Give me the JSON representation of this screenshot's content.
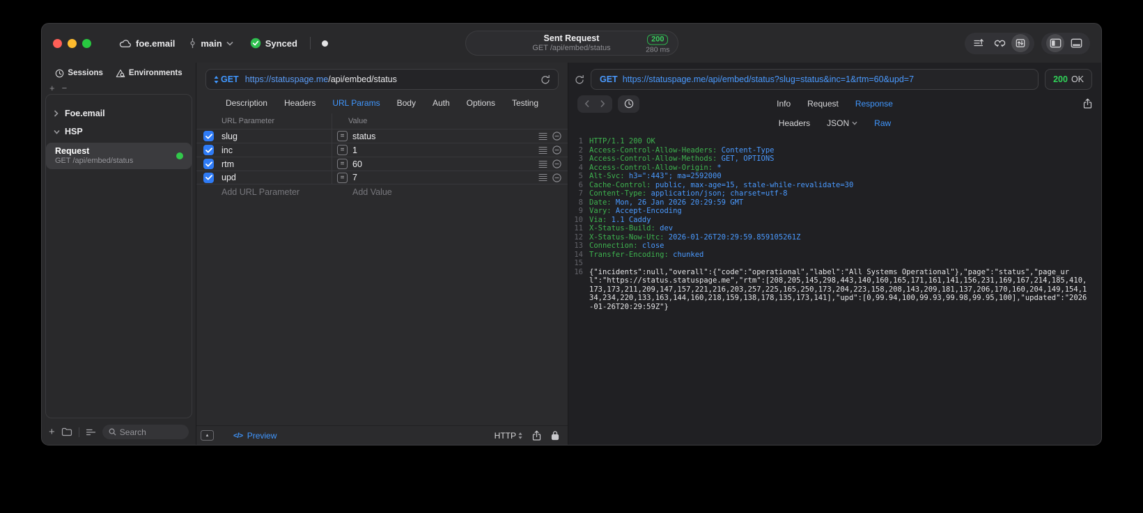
{
  "titlebar": {
    "project": "foe.email",
    "branch": "main",
    "sync_status": "Synced",
    "request_summary": {
      "title": "Sent Request",
      "subtitle": "GET /api/embed/status",
      "status_code": "200",
      "duration": "280 ms"
    }
  },
  "sidebar": {
    "tabs": [
      {
        "label": "Sessions"
      },
      {
        "label": "Environments"
      }
    ],
    "groups": [
      {
        "label": "Foe.email",
        "expanded": false
      },
      {
        "label": "HSP",
        "expanded": true
      }
    ],
    "selected_request": {
      "title": "Request",
      "subtitle": "GET /api/embed/status"
    },
    "search_placeholder": "Search"
  },
  "request_editor": {
    "method": "GET",
    "url_host": "https://statuspage.me",
    "url_path": "/api/embed/status",
    "tabs": [
      "Description",
      "Headers",
      "URL Params",
      "Body",
      "Auth",
      "Options",
      "Testing"
    ],
    "active_tab": "URL Params",
    "params_table": {
      "columns": [
        "URL Parameter",
        "Value"
      ],
      "rows": [
        {
          "enabled": true,
          "name": "slug",
          "value": "status"
        },
        {
          "enabled": true,
          "name": "inc",
          "value": "1"
        },
        {
          "enabled": true,
          "name": "rtm",
          "value": "60"
        },
        {
          "enabled": true,
          "name": "upd",
          "value": "7"
        }
      ],
      "add_parameter_placeholder": "Add URL Parameter",
      "add_value_placeholder": "Add Value"
    },
    "footer": {
      "preview_label": "Preview",
      "code_glyph": "</>",
      "protocol_selector": "HTTP"
    }
  },
  "response_viewer": {
    "request_method": "GET",
    "request_url": "https://statuspage.me/api/embed/status?slug=status&inc=1&rtm=60&upd=7",
    "status_code": "200",
    "status_text": "OK",
    "tabs": [
      "Info",
      "Request",
      "Response"
    ],
    "active_tab": "Response",
    "subtabs": [
      "Headers",
      "JSON",
      "Raw"
    ],
    "active_subtab": "Raw",
    "headers_lines": [
      {
        "name": "HTTP/1.1 200 OK",
        "value": ""
      },
      {
        "name": "Access-Control-Allow-Headers:",
        "value": " Content-Type"
      },
      {
        "name": "Access-Control-Allow-Methods:",
        "value": " GET, OPTIONS"
      },
      {
        "name": "Access-Control-Allow-Origin:",
        "value": " *"
      },
      {
        "name": "Alt-Svc:",
        "value": " h3=\":443\"; ma=2592000"
      },
      {
        "name": "Cache-Control:",
        "value": " public, max-age=15, stale-while-revalidate=30"
      },
      {
        "name": "Content-Type:",
        "value": " application/json; charset=utf-8"
      },
      {
        "name": "Date:",
        "value": " Mon, 26 Jan 2026 20:29:59 GMT"
      },
      {
        "name": "Vary:",
        "value": " Accept-Encoding"
      },
      {
        "name": "Via:",
        "value": " 1.1 Caddy"
      },
      {
        "name": "X-Status-Build:",
        "value": " dev"
      },
      {
        "name": "X-Status-Now-Utc:",
        "value": " 2026-01-26T20:29:59.859105261Z"
      },
      {
        "name": "Connection:",
        "value": " close"
      },
      {
        "name": "Transfer-Encoding:",
        "value": " chunked"
      },
      {
        "name": "",
        "value": ""
      }
    ],
    "body": "{\"incidents\":null,\"overall\":{\"code\":\"operational\",\"label\":\"All Systems Operational\"},\"page\":\"status\",\"page_url\":\"https://status.statuspage.me\",\"rtm\":[208,205,145,298,443,140,160,165,171,161,141,156,231,169,167,214,185,410,173,173,211,209,147,157,221,216,203,257,225,165,250,173,204,223,158,208,143,209,181,137,206,170,160,204,149,154,134,234,220,133,163,144,160,218,159,138,178,135,173,141],\"upd\":[0,99.94,100,99.93,99.98,99.95,100],\"updated\":\"2026-01-26T20:29:59Z\"}"
  }
}
